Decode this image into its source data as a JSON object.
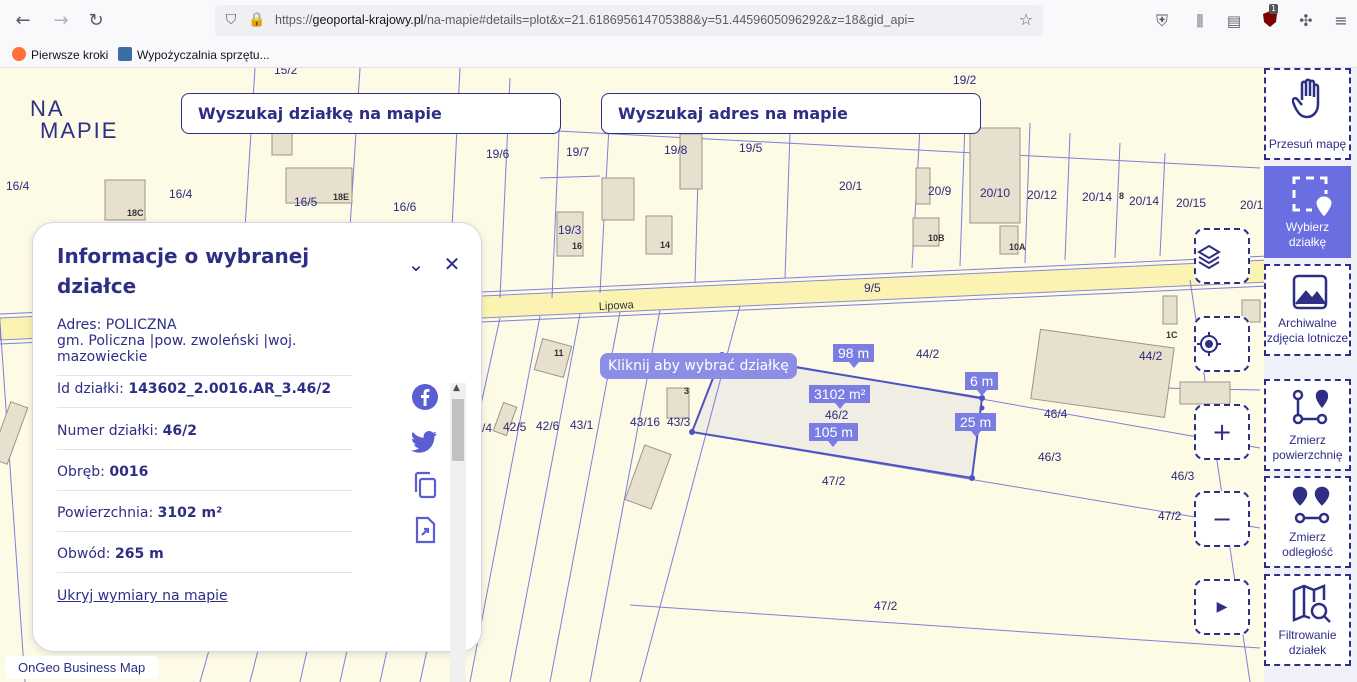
{
  "browser": {
    "url_prefix": "https://",
    "url_domain": "geoportal-krajowy.pl",
    "url_rest": "/na-mapie#details=plot&x=21.618695614705388&y=51.4459605096292&z=18&gid_api=",
    "bookmarks": [
      "Pierwsze kroki",
      "Wypożyczalnia sprzętu..."
    ],
    "ext_badge": "1"
  },
  "logo": {
    "line1": "NA",
    "line2": "MAPIE"
  },
  "search": {
    "plot_label": "Wyszukaj działkę na mapie",
    "address_label": "Wyszukaj adres na mapie"
  },
  "info": {
    "title": "Informacje o wybranej działce",
    "address_label": "Adres:",
    "address_value": "POLICZNA",
    "address_sub": "gm. Policzna |pow. zwoleński |woj. mazowieckie",
    "id_label": "Id działki:",
    "id_value": "143602_2.0016.AR_3.46/2",
    "number_label": "Numer działki:",
    "number_value": "46/2",
    "precinct_label": "Obręb:",
    "precinct_value": "0016",
    "area_label": "Powierzchnia:",
    "area_value": "3102 m²",
    "perimeter_label": "Obwód:",
    "perimeter_value": "265 m",
    "hide_dims_link": "Ukryj wymiary na mapie"
  },
  "map": {
    "street": "Lipowa",
    "tooltip": "Kliknij aby wybrać działkę",
    "measurements": [
      "98 m",
      "3102 m²",
      "6 m",
      "105 m",
      "25 m"
    ],
    "plot_labels": [
      "15/2",
      "19/2",
      "16/4",
      "16/4",
      "16/5",
      "16/6",
      "19/6",
      "19/7",
      "19/8",
      "19/5",
      "20/1",
      "20/9",
      "20/10",
      "20/12",
      "20/14",
      "20/14",
      "20/15",
      "20/1",
      "19/3",
      "9/5",
      "44/2",
      "44/2",
      "46/2",
      "46/4",
      "46/3",
      "46/3",
      "47/2",
      "47/2",
      "47/2",
      "43/1",
      "42/6",
      "42/5",
      "/4",
      "43/16",
      "43/3"
    ],
    "building_labels": [
      "18C",
      "18E",
      "16",
      "14",
      "10B",
      "10A",
      "8",
      "11",
      "3",
      "1C"
    ]
  },
  "tools": [
    {
      "label": "Przesuń mapę",
      "icon": "hand-icon"
    },
    {
      "label": "Wybierz działkę",
      "icon": "select-plot-icon"
    },
    {
      "label": "Archiwalne zdjęcia lotnicze",
      "icon": "image-icon"
    },
    {
      "label": "Zmierz powierzchnię",
      "icon": "measure-area-icon"
    },
    {
      "label": "Zmierz odległość",
      "icon": "measure-distance-icon"
    },
    {
      "label": "Filtrowanie działek",
      "icon": "map-search-icon"
    }
  ],
  "footer": {
    "label": "OnGeo Business Map"
  }
}
